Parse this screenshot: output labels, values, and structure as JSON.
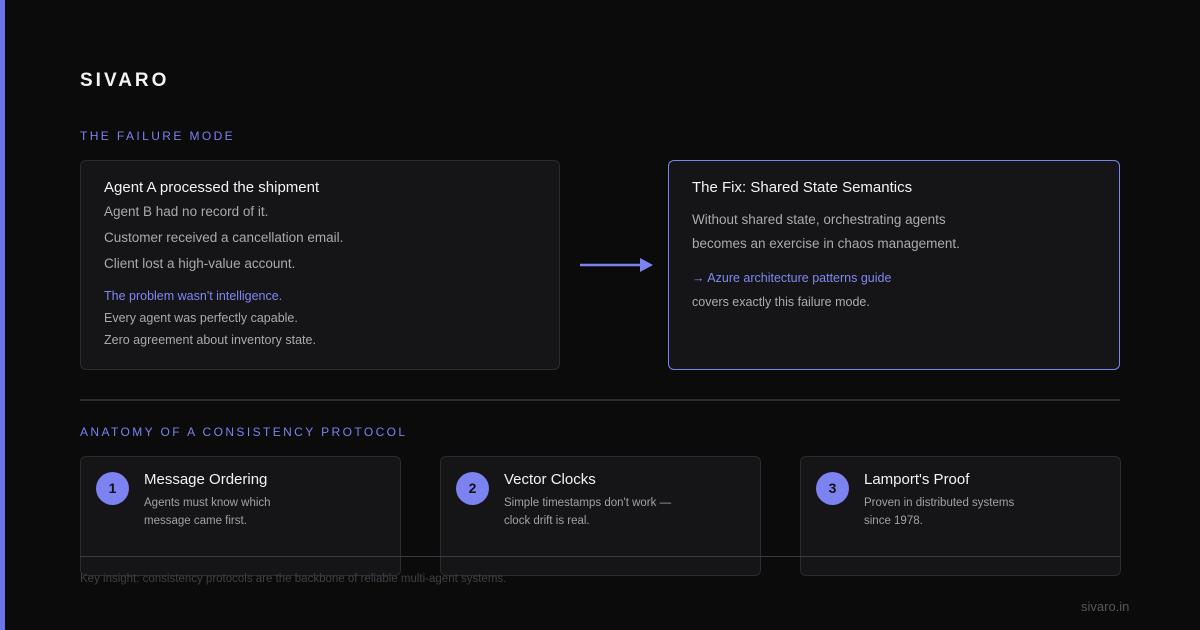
{
  "brand": "SIVARO",
  "failure_section": {
    "label": "THE FAILURE MODE",
    "title": "Agent A processed the shipment",
    "lines": [
      "Agent B had no record of it.",
      "Customer received a cancellation email.",
      "Client lost a high-value account."
    ],
    "problem": "The problem wasn't intelligence.",
    "notes": [
      "Every agent was perfectly capable.",
      "Zero agreement about inventory state."
    ]
  },
  "fix_card": {
    "title": "The Fix: Shared State Semantics",
    "body_lines": [
      "Without shared state, orchestrating agents",
      "becomes an exercise in chaos management."
    ],
    "link": "→ Azure architecture patterns guide",
    "after_link": "covers exactly this failure mode."
  },
  "anatomy_section": {
    "label": "ANATOMY OF A CONSISTENCY PROTOCOL",
    "steps": [
      {
        "number": "1",
        "title": "Message Ordering",
        "desc": [
          "Agents must know which",
          "message came first."
        ]
      },
      {
        "number": "2",
        "title": "Vector Clocks",
        "desc": [
          "Simple timestamps don't work —",
          "clock drift is real."
        ]
      },
      {
        "number": "3",
        "title": "Lamport's Proof",
        "desc": [
          "Proven in distributed systems",
          "since 1978."
        ]
      }
    ]
  },
  "insight": "Key insight: consistency protocols are the backbone of reliable multi-agent systems.",
  "site": "sivaro.in",
  "colors": {
    "background": "#0b0b0c",
    "accent": "#7c82f0",
    "card": "#151518"
  }
}
